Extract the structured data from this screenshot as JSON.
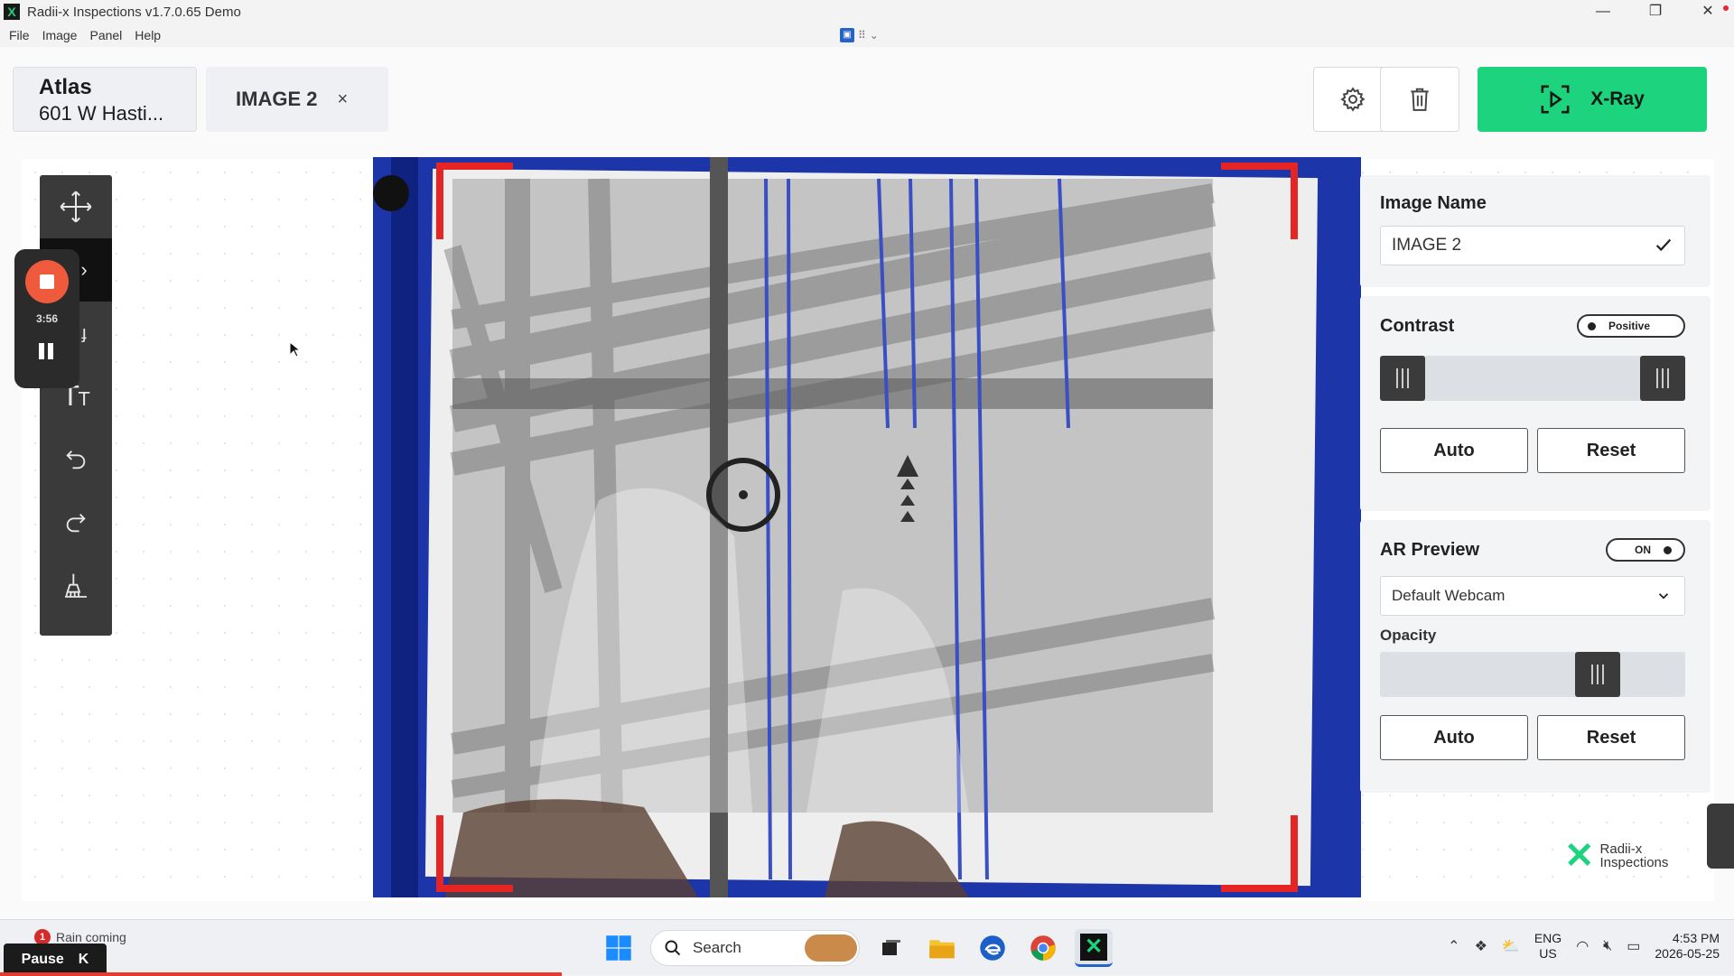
{
  "window": {
    "title": "Radii-x Inspections v1.7.0.65 Demo",
    "minimize": "—",
    "restore": "❐",
    "close": "✕"
  },
  "menu": [
    "File",
    "Image",
    "Panel",
    "Help"
  ],
  "tabs": {
    "atlas": {
      "title": "Atlas",
      "subtitle": "601 W Hasti..."
    },
    "image": {
      "label": "IMAGE 2",
      "close": "×"
    }
  },
  "actions": {
    "xray_label": "X-Ray"
  },
  "recorder": {
    "time": "3:56"
  },
  "panel": {
    "image_name": {
      "heading": "Image Name",
      "value": "IMAGE 2"
    },
    "contrast": {
      "heading": "Contrast",
      "mode": "Positive",
      "low": 0,
      "high": 1,
      "auto": "Auto",
      "reset": "Reset"
    },
    "ar_preview": {
      "heading": "AR Preview",
      "toggle": "ON",
      "camera": "Default Webcam",
      "opacity_label": "Opacity",
      "opacity": 0.75,
      "auto": "Auto",
      "reset": "Reset"
    }
  },
  "brand": {
    "line1": "Radii-x",
    "line2": "Inspections"
  },
  "taskbar": {
    "weather": "Rain coming",
    "weather_badge": "1",
    "pause_label": "Pause",
    "pause_key": "K",
    "search": "Search",
    "lang1": "ENG",
    "lang2": "US",
    "time": "4:53 PM",
    "date": "2026-05-25"
  },
  "colors": {
    "accent": "#1ed37d",
    "brand_blue": "#1c35a8",
    "frame_red": "#e52424",
    "record": "#ef5a3d"
  }
}
